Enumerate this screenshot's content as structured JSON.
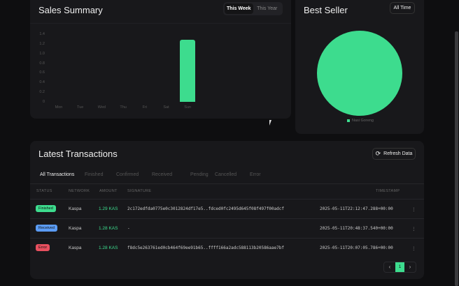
{
  "sales": {
    "title": "Sales Summary",
    "tabs": [
      "This Week",
      "This Year"
    ]
  },
  "chart_data": {
    "type": "bar",
    "categories": [
      "Mon",
      "Tue",
      "Wed",
      "Thu",
      "Fri",
      "Sat",
      "Sun"
    ],
    "values": [
      0,
      0,
      0,
      0,
      0,
      0,
      1.29
    ],
    "yticks": [
      "0",
      "0.2",
      "0.4",
      "0.6",
      "0.8",
      "1.0",
      "1.2",
      "1.4"
    ],
    "ylim": [
      0,
      1.4
    ],
    "color": "#3ddc8e"
  },
  "best": {
    "title": "Best Seller",
    "filter": "All Time",
    "pie": [
      {
        "name": "Nasi Goreng",
        "value": 1
      }
    ],
    "color": "#3ddc8e"
  },
  "tx": {
    "title": "Latest Transactions",
    "refresh": "Refresh Data",
    "tabs": [
      "All Transactions",
      "Finished",
      "Confirmed",
      "Received",
      "Pending",
      "Cancelled",
      "Error"
    ],
    "headers": [
      "STATUS",
      "NETWORK",
      "AMOUNT",
      "SIGNATURE",
      "TIMESTAMP"
    ],
    "rows": [
      {
        "status": "Finished",
        "color": "#3ddc8e",
        "network": "Kaspa",
        "amount": "1.29 KAS",
        "signature": "2c172edfda0775e0c3012824df17e5..fdced0fc2495d645f08f497f00adcf",
        "timestamp": "2025-05-11T22:12:47.288+00:00"
      },
      {
        "status": "Received",
        "color": "#5b9cf5",
        "network": "Kaspa",
        "amount": "1.28 KAS",
        "signature": "-",
        "timestamp": "2025-05-11T20:48:37.540+00:00"
      },
      {
        "status": "Error",
        "color": "#e8505f",
        "network": "Kaspa",
        "amount": "1.28 KAS",
        "signature": "f8dc5e263761ed0cb464f69ee91b65..ffff166a2adc588113b20586aae7bf",
        "timestamp": "2025-05-11T20:07:05.786+00:00"
      }
    ],
    "page": "1",
    "prev": "‹",
    "next": "›",
    "more": "⋮"
  }
}
